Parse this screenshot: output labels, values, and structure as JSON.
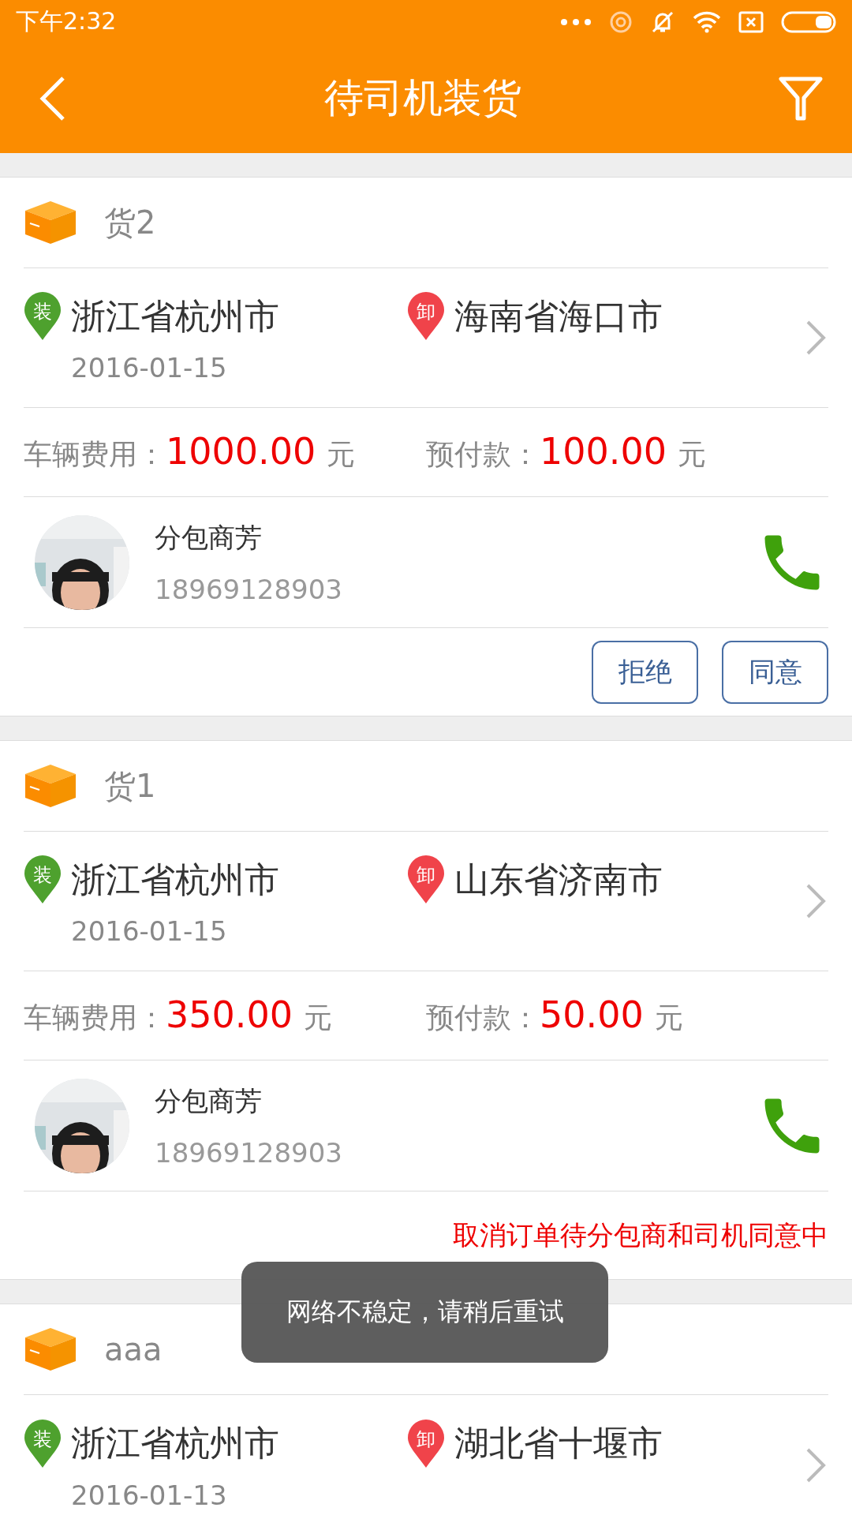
{
  "status_bar": {
    "time": "下午2:32"
  },
  "header": {
    "title": "待司机装货"
  },
  "orders": [
    {
      "name": "货2",
      "from": {
        "badge": "装",
        "city": "浙江省杭州市"
      },
      "to": {
        "badge": "卸",
        "city": "海南省海口市"
      },
      "date": "2016-01-15",
      "fee_label": "车辆费用：",
      "fee": "1000.00",
      "fee_unit": "元",
      "prepay_label": "预付款：",
      "prepay": "100.00",
      "prepay_unit": "元",
      "contact": {
        "name": "分包商芳",
        "phone": "18969128903"
      },
      "footer": {
        "kind": "actions",
        "buttons": [
          "拒绝",
          "同意"
        ]
      }
    },
    {
      "name": "货1",
      "from": {
        "badge": "装",
        "city": "浙江省杭州市"
      },
      "to": {
        "badge": "卸",
        "city": "山东省济南市"
      },
      "date": "2016-01-15",
      "fee_label": "车辆费用：",
      "fee": "350.00",
      "fee_unit": "元",
      "prepay_label": "预付款：",
      "prepay": "50.00",
      "prepay_unit": "元",
      "contact": {
        "name": "分包商芳",
        "phone": "18969128903"
      },
      "footer": {
        "kind": "status",
        "text": "取消订单待分包商和司机同意中"
      }
    },
    {
      "name": "aaa",
      "from": {
        "badge": "装",
        "city": "浙江省杭州市"
      },
      "to": {
        "badge": "卸",
        "city": "湖北省十堰市"
      },
      "date": "2016-01-13"
    }
  ],
  "toast": {
    "text": "网络不稳定，请稍后重试"
  }
}
